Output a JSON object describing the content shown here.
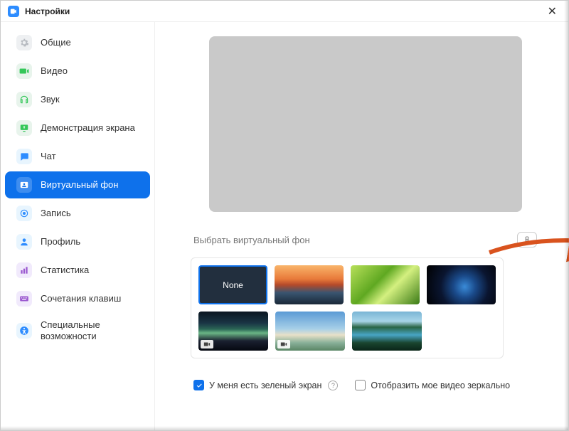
{
  "window": {
    "title": "Настройки"
  },
  "sidebar": {
    "items": [
      {
        "label": "Общие"
      },
      {
        "label": "Видео"
      },
      {
        "label": "Звук"
      },
      {
        "label": "Демонстрация экрана"
      },
      {
        "label": "Чат"
      },
      {
        "label": "Виртуальный фон"
      },
      {
        "label": "Запись"
      },
      {
        "label": "Профиль"
      },
      {
        "label": "Статистика"
      },
      {
        "label": "Сочетания клавиш"
      },
      {
        "label": "Специальные возможности"
      }
    ]
  },
  "content": {
    "section_title": "Выбрать виртуальный фон",
    "none_label": "None",
    "green_screen_label": "У меня есть зеленый экран",
    "mirror_label": "Отобразить мое видео зеркально"
  },
  "colors": {
    "accent": "#0e71eb",
    "annotation": "#d9531e"
  }
}
